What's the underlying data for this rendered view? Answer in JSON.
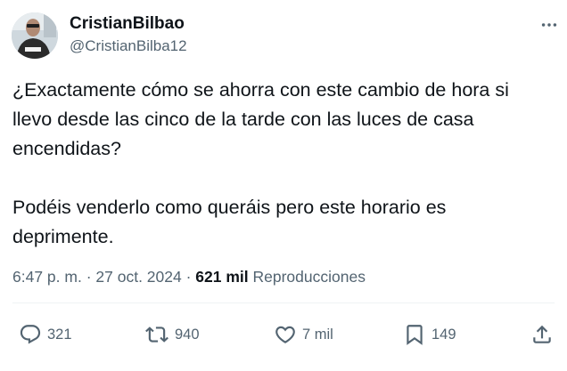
{
  "author": {
    "name": "CristianBilbao",
    "handle": "@CristianBilba12"
  },
  "tweet": {
    "paragraph1": "¿Exactamente cómo se ahorra con este cambio de hora si llevo desde las cinco de la tarde con las luces de casa encendidas?",
    "paragraph2": "Podéis venderlo como queráis pero este horario es deprimente."
  },
  "meta": {
    "time": "6:47 p. m.",
    "separator1": " · ",
    "date": "27 oct. 2024",
    "separator2": " · ",
    "views_count": "621 mil",
    "views_label": " Reproducciones"
  },
  "actions": {
    "replies": "321",
    "retweets": "940",
    "likes": "7 mil",
    "bookmarks": "149"
  },
  "icons": {
    "more": "more-options-icon",
    "reply": "reply-icon",
    "retweet": "retweet-icon",
    "like": "heart-icon",
    "bookmark": "bookmark-icon",
    "share": "share-icon"
  },
  "colors": {
    "text": "#0f1419",
    "secondary": "#536471",
    "divider": "#eff3f4"
  }
}
